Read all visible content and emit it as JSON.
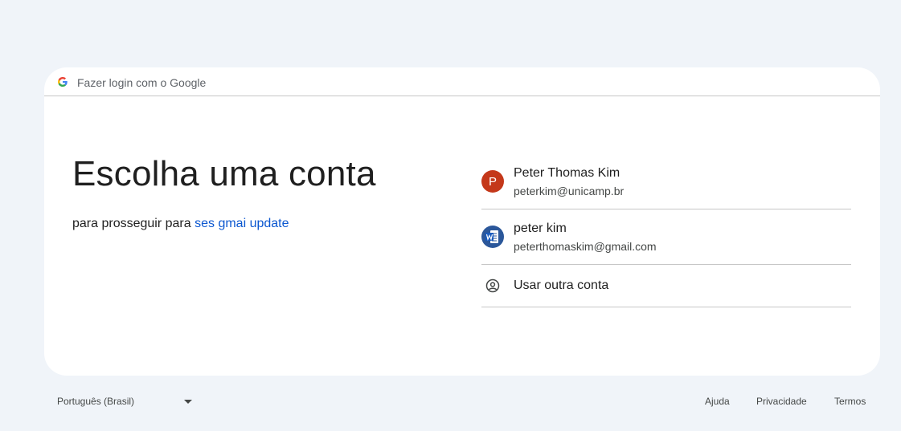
{
  "header": {
    "text": "Fazer login com o Google"
  },
  "main": {
    "title": "Escolha uma conta",
    "subtitle_prefix": "para prosseguir para ",
    "app_name": "ses gmai update"
  },
  "accounts": [
    {
      "avatar_letter": "P",
      "name": "Peter Thomas Kim",
      "email": "peterkim@unicamp.br"
    },
    {
      "avatar_icon": "word-doc-icon",
      "name": "peter kim",
      "email": "peterthomaskim@gmail.com"
    }
  ],
  "other_account": {
    "label": "Usar outra conta",
    "icon": "account-circle-icon"
  },
  "footer": {
    "language": "Português (Brasil)",
    "help": "Ajuda",
    "privacy": "Privacidade",
    "terms": "Termos"
  },
  "colors": {
    "background": "#f0f4f9",
    "card": "#ffffff",
    "link": "#0b57d0",
    "avatar_letter_bg": "#c4381a",
    "avatar_word_bg": "#2b579a"
  }
}
